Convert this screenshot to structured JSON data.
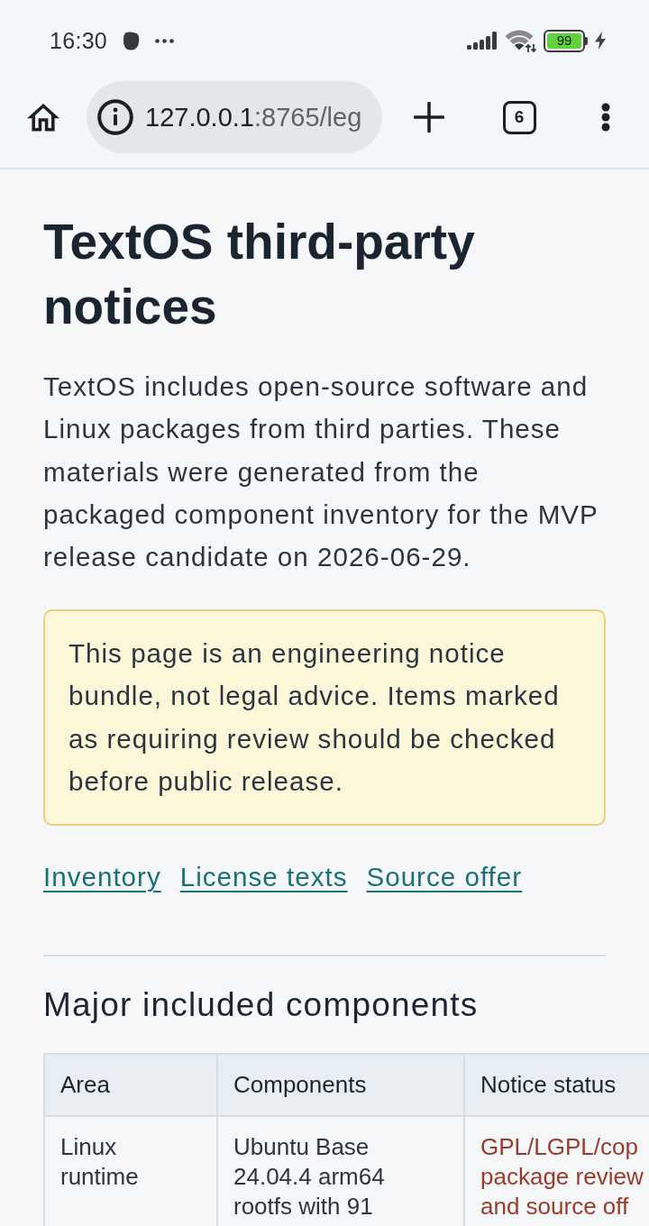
{
  "status_bar": {
    "time": "16:30",
    "battery": "99"
  },
  "browser": {
    "url_host": "127.0.0.1",
    "url_path": ":8765/leg",
    "tab_count": "6"
  },
  "page": {
    "title": "TextOS third-party notices",
    "intro": "TextOS includes open-source software and Linux packages from third parties. These materials were generated from the packaged component inventory for the MVP release candidate on 2026-06-29.",
    "notice": "This page is an engineering notice bundle, not legal advice. Items marked as requiring review should be checked before public release.",
    "links": [
      "Inventory",
      "License texts",
      "Source offer"
    ],
    "section_title": "Major included components"
  },
  "table": {
    "columns": [
      "Area",
      "Components",
      "Notice status"
    ],
    "rows": [
      {
        "cells": [
          {
            "kind": "text",
            "text": "Linux runtime"
          },
          {
            "kind": "text",
            "text": "Ubuntu Base 24.04.4 arm64 rootfs with 91"
          },
          {
            "kind": "status",
            "text": "GPL/LGPL/cop package review and source off"
          }
        ]
      }
    ]
  }
}
